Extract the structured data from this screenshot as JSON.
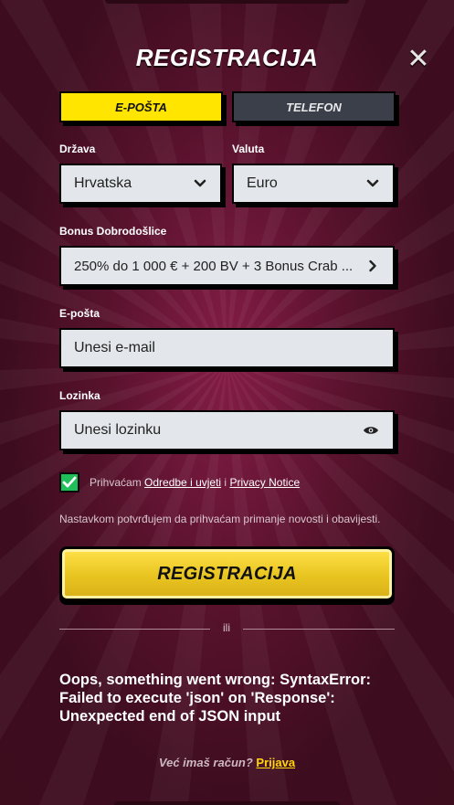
{
  "header": {
    "title": "REGISTRACIJA",
    "close_icon": "close-icon"
  },
  "tabs": [
    {
      "label": "E-POŠTA",
      "active": true,
      "color": "#ffe500"
    },
    {
      "label": "TELEFON",
      "active": false,
      "color": "#3a3f4a"
    }
  ],
  "form": {
    "country": {
      "label": "Država",
      "value": "Hrvatska",
      "icon": "chevron-down-icon"
    },
    "currency": {
      "label": "Valuta",
      "value": "Euro",
      "icon": "chevron-down-icon"
    },
    "bonus": {
      "label": "Bonus Dobrodošlice",
      "value": "250% do 1 000 € + 200 BV + 3 Bonus Crab ...",
      "icon": "chevron-right-icon"
    },
    "email": {
      "label": "E-pošta",
      "placeholder": "Unesi e-mail"
    },
    "password": {
      "label": "Lozinka",
      "placeholder": "Unesi lozinku",
      "icon": "eye-icon"
    },
    "consent": {
      "checked": true,
      "prefix": "Prihvaćam",
      "terms_link": "Odredbe i uvjeti",
      "separator": "i",
      "privacy_link": "Privacy Notice",
      "check_color": "#1fbf5a"
    },
    "notice": "Nastavkom potvrđujem da prihvaćam primanje novosti i obavijesti.",
    "submit_label": "REGISTRACIJA"
  },
  "divider_text": "ili",
  "error_message": "Oops, something went wrong: SyntaxError: Failed to execute 'json' on 'Response': Unexpected end of JSON input",
  "footer": {
    "question": "Već imaš račun?",
    "login_link": "Prijava",
    "link_color": "#ffd60a"
  }
}
